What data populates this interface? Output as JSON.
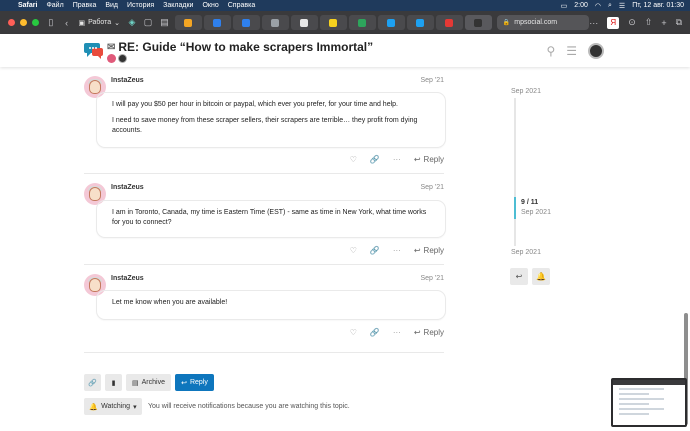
{
  "menubar": {
    "app": "Safari",
    "items": [
      "Файл",
      "Правка",
      "Вид",
      "История",
      "Закладки",
      "Окно",
      "Справка"
    ],
    "time": "2:00",
    "datetime": "Пт, 12 авг.  01:30"
  },
  "browser": {
    "tab_group": "Работа",
    "url": "mpsocial.com",
    "tab_colors": [
      "#f5a623",
      "#2f80ed",
      "#2f80ed",
      "#9aa0a6",
      "#e8e8e8",
      "#f7d21e",
      "#2ea55c",
      "#1da1f2",
      "#1da1f2",
      "#e53935",
      "#333333"
    ]
  },
  "header": {
    "title": "RE: Guide “How to make scrapers Immortal”"
  },
  "posts": [
    {
      "username": "InstaZeus",
      "date": "Sep '21",
      "paragraphs": [
        "I will pay you $50 per hour in bitcoin or paypal, which ever you prefer, for your time and help.",
        "I need to save money from these scraper sellers, their scrapers are terrible… they profit from dying accounts."
      ],
      "reply_label": "Reply"
    },
    {
      "username": "InstaZeus",
      "date": "Sep '21",
      "paragraphs": [
        "I am in Toronto, Canada, my time is Eastern Time (EST) - same as time in New York, what time works for you to connect?"
      ],
      "reply_label": "Reply"
    },
    {
      "username": "InstaZeus",
      "date": "Sep '21",
      "paragraphs": [
        "Let me know when you are available!"
      ],
      "reply_label": "Reply"
    }
  ],
  "timeline": {
    "top_date": "Sep 2021",
    "position": "9 / 11",
    "position_date": "Sep 2021",
    "bottom_date": "Sep 2021"
  },
  "footer": {
    "archive_label": "Archive",
    "reply_label": "Reply",
    "notification_label": "Watching",
    "notification_text": "You will receive notifications because you are watching this topic."
  }
}
